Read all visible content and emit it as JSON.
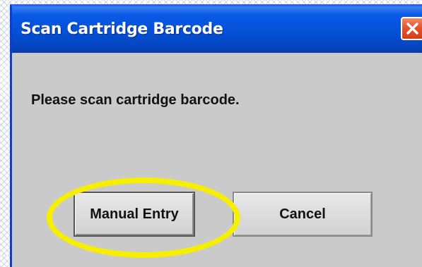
{
  "dialog": {
    "title": "Scan Cartridge Barcode",
    "message": "Please scan cartridge barcode.",
    "buttons": {
      "manual_entry": "Manual Entry",
      "cancel": "Cancel"
    },
    "close_icon": "close-x-icon"
  },
  "colors": {
    "titlebar": "#0450d6",
    "dialog_background": "#cacaca",
    "close_button": "#e2542e",
    "highlight": "#f6f000"
  }
}
